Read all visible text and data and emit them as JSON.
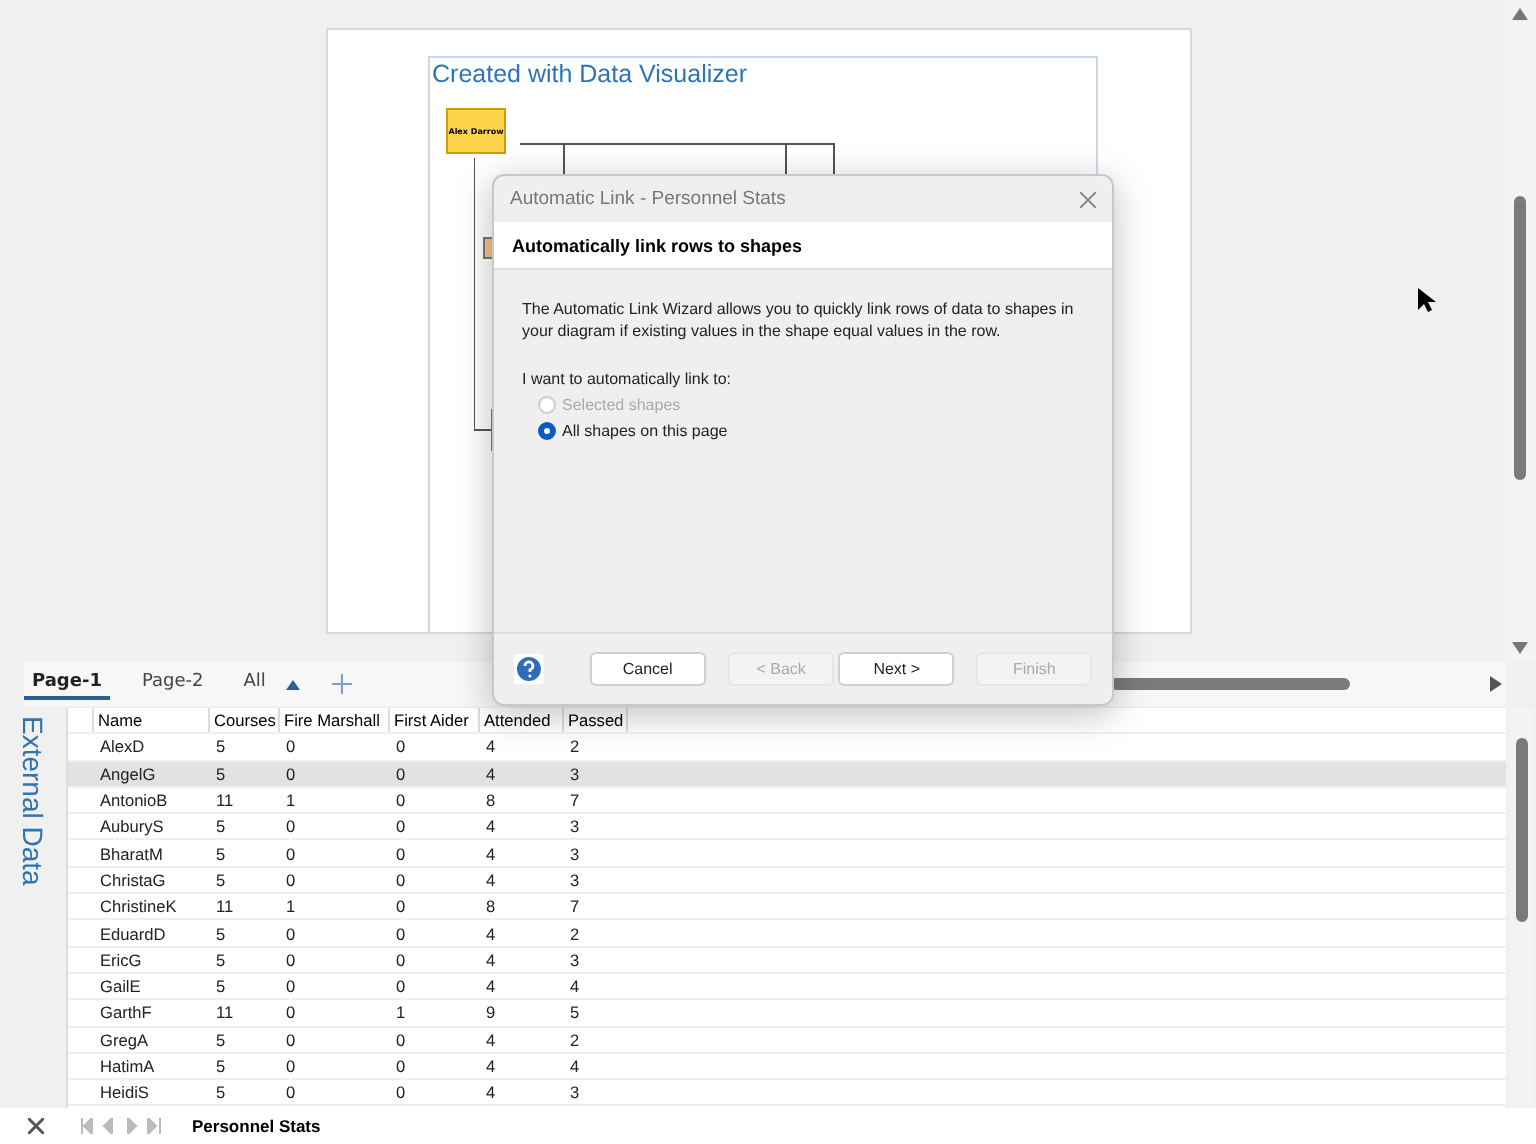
{
  "diagram": {
    "title": "Created with Data Visualizer",
    "top_shape": "Alex Darrow"
  },
  "dialog": {
    "title": "Automatic Link - Personnel Stats",
    "heading": "Automatically link rows to shapes",
    "description": "The Automatic Link Wizard allows you to quickly link rows of data to shapes in your diagram if existing values in the shape equal values in the row.",
    "prompt": "I want to automatically link to:",
    "options": [
      {
        "label": "Selected shapes",
        "selected": false,
        "disabled": true
      },
      {
        "label": "All shapes on this page",
        "selected": true,
        "disabled": false
      }
    ],
    "buttons": [
      {
        "label": "Cancel",
        "disabled": false
      },
      {
        "label": "< Back",
        "disabled": true
      },
      {
        "label": "Next >",
        "disabled": false
      },
      {
        "label": "Finish",
        "disabled": true
      }
    ]
  },
  "page_tabs": [
    {
      "label": "Page-1",
      "selected": true
    },
    {
      "label": "Page-2",
      "selected": false
    },
    {
      "label": "All",
      "selected": false
    }
  ],
  "external_data": {
    "title": "External Data",
    "columns": [
      "Name",
      "Courses",
      "Fire Marshall",
      "First Aider",
      "Attended",
      "Passed"
    ],
    "rows": [
      {
        "cells": [
          "AlexD",
          "5",
          "0",
          "0",
          "4",
          "2"
        ],
        "selected": false
      },
      {
        "cells": [
          "AngelG",
          "5",
          "0",
          "0",
          "4",
          "3"
        ],
        "selected": true
      },
      {
        "cells": [
          "AntonioB",
          "11",
          "1",
          "0",
          "8",
          "7"
        ],
        "selected": false
      },
      {
        "cells": [
          "AuburyS",
          "5",
          "0",
          "0",
          "4",
          "3"
        ],
        "selected": false
      },
      {
        "cells": [
          "BharatM",
          "5",
          "0",
          "0",
          "4",
          "3"
        ],
        "selected": false
      },
      {
        "cells": [
          "ChristaG",
          "5",
          "0",
          "0",
          "4",
          "3"
        ],
        "selected": false
      },
      {
        "cells": [
          "ChristineK",
          "11",
          "1",
          "0",
          "8",
          "7"
        ],
        "selected": false
      },
      {
        "cells": [
          "EduardD",
          "5",
          "0",
          "0",
          "4",
          "2"
        ],
        "selected": false
      },
      {
        "cells": [
          "EricG",
          "5",
          "0",
          "0",
          "4",
          "3"
        ],
        "selected": false
      },
      {
        "cells": [
          "GailE",
          "5",
          "0",
          "0",
          "4",
          "4"
        ],
        "selected": false
      },
      {
        "cells": [
          "GarthF",
          "11",
          "0",
          "1",
          "9",
          "5"
        ],
        "selected": false
      },
      {
        "cells": [
          "GregA",
          "5",
          "0",
          "0",
          "4",
          "2"
        ],
        "selected": false
      },
      {
        "cells": [
          "HatimA",
          "5",
          "0",
          "0",
          "4",
          "4"
        ],
        "selected": false
      },
      {
        "cells": [
          "HeidiS",
          "5",
          "0",
          "0",
          "4",
          "3"
        ],
        "selected": false
      }
    ],
    "sheet_tab": "Personnel Stats"
  }
}
